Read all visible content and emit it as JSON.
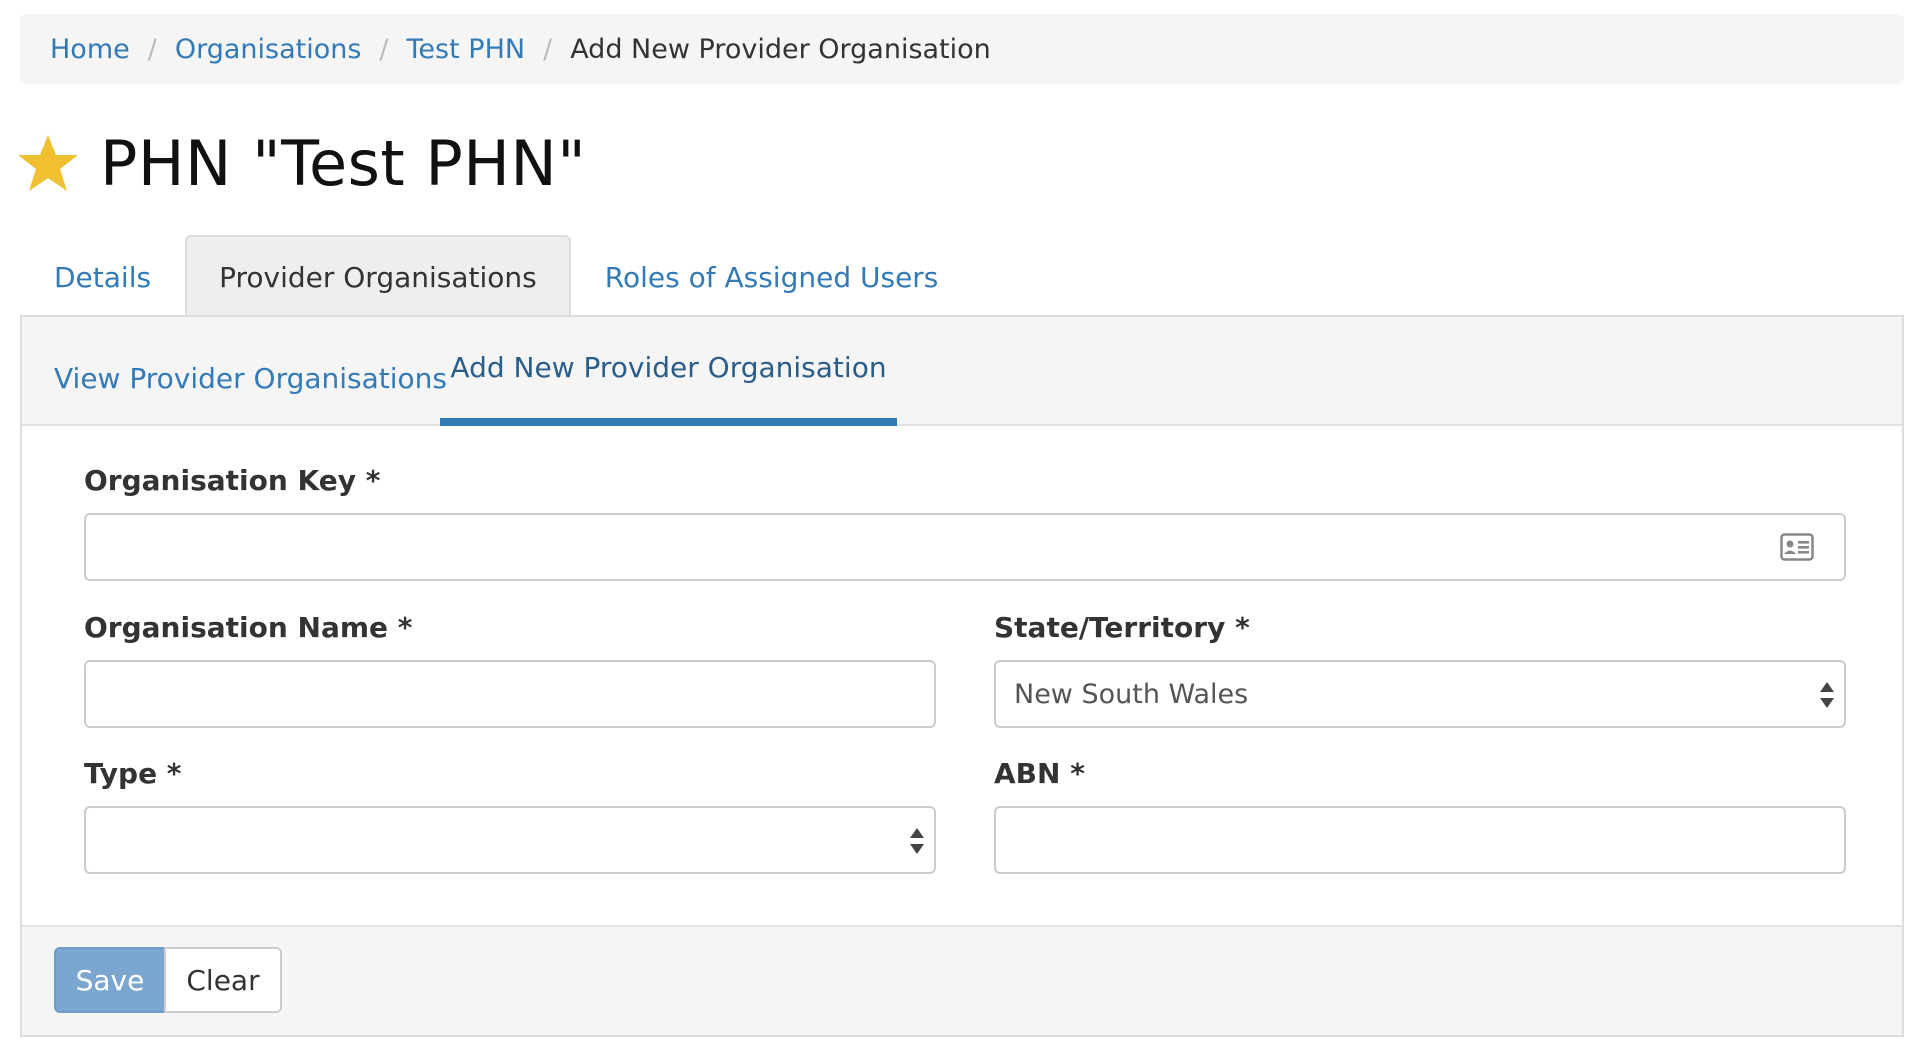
{
  "breadcrumb": {
    "items": [
      "Home",
      "Organisations",
      "Test PHN"
    ],
    "current": "Add New Provider Organisation",
    "separator": "/"
  },
  "page": {
    "title": "PHN \"Test PHN\"",
    "star_color": "#f0c030"
  },
  "tabs": [
    {
      "label": "Details",
      "active": false
    },
    {
      "label": "Provider Organisations",
      "active": true
    },
    {
      "label": "Roles of Assigned Users",
      "active": false
    }
  ],
  "subtabs": [
    {
      "label": "View Provider Organisations",
      "active": false
    },
    {
      "label": "Add New Provider Organisation",
      "active": true
    }
  ],
  "form": {
    "org_key": {
      "label": "Organisation Key *",
      "value": "",
      "icon": "id-card-icon"
    },
    "org_name": {
      "label": "Organisation Name *",
      "value": ""
    },
    "state": {
      "label": "State/Territory *",
      "value": "New South Wales"
    },
    "type": {
      "label": "Type *",
      "value": ""
    },
    "abn": {
      "label": "ABN *",
      "value": ""
    }
  },
  "actions": {
    "save_label": "Save",
    "clear_label": "Clear"
  },
  "colors": {
    "link": "#337ab7",
    "save_button": "#7aa6d0",
    "active_underline": "#337ab7"
  }
}
